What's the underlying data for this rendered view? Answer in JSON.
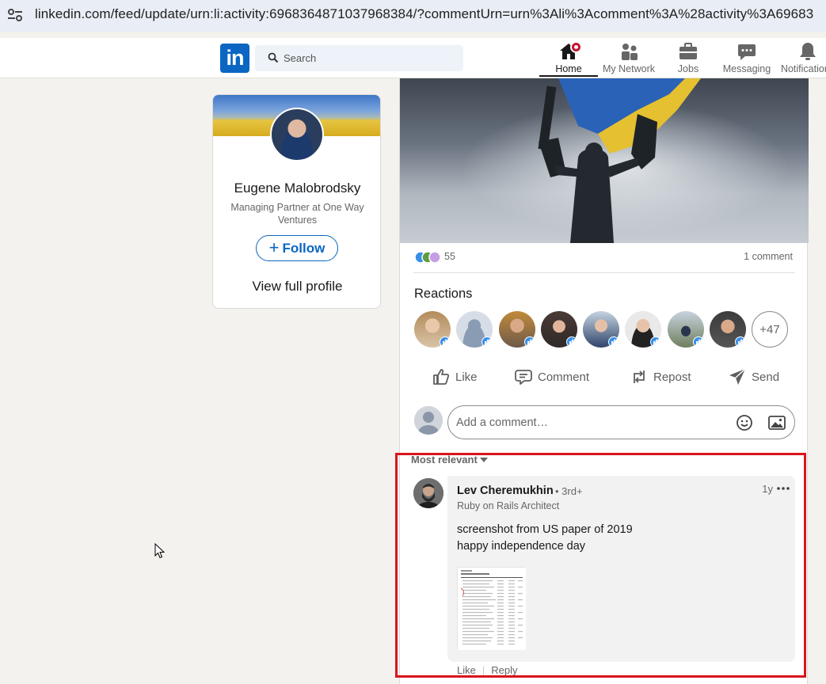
{
  "browser": {
    "url": "linkedin.com/feed/update/urn:li:activity:6968364871037968384/?commentUrn=urn%3Ali%3Acomment%3A%28activity%3A69683"
  },
  "header": {
    "logo_text": "in",
    "search_placeholder": "Search",
    "nav": [
      {
        "label": "Home",
        "icon": "home-icon",
        "active": true
      },
      {
        "label": "My Network",
        "icon": "people-icon"
      },
      {
        "label": "Jobs",
        "icon": "briefcase-icon"
      },
      {
        "label": "Messaging",
        "icon": "chat-icon"
      },
      {
        "label": "Notifications",
        "icon": "bell-icon"
      }
    ]
  },
  "profile_card": {
    "name": "Eugene Malobrodsky",
    "headline": "Managing Partner at One Way Ventures",
    "follow_label": "Follow",
    "view_profile_label": "View full profile"
  },
  "post": {
    "reaction_count": "55",
    "comment_count": "1 comment",
    "reactions_title": "Reactions",
    "more_reactors": "+47",
    "actions": {
      "like": "Like",
      "comment": "Comment",
      "repost": "Repost",
      "send": "Send"
    },
    "composer_placeholder": "Add a comment…",
    "sort_label": "Most relevant",
    "colors": {
      "brand": "#0a66c2",
      "highlight": "#d9151d"
    }
  },
  "comment": {
    "author": "Lev Cheremukhin",
    "degree": "• 3rd+",
    "headline": "Ruby on Rails Architect",
    "time": "1y",
    "text_line1": "screenshot from US paper of 2019",
    "text_line2": "happy independence day",
    "like_label": "Like",
    "reply_label": "Reply"
  }
}
